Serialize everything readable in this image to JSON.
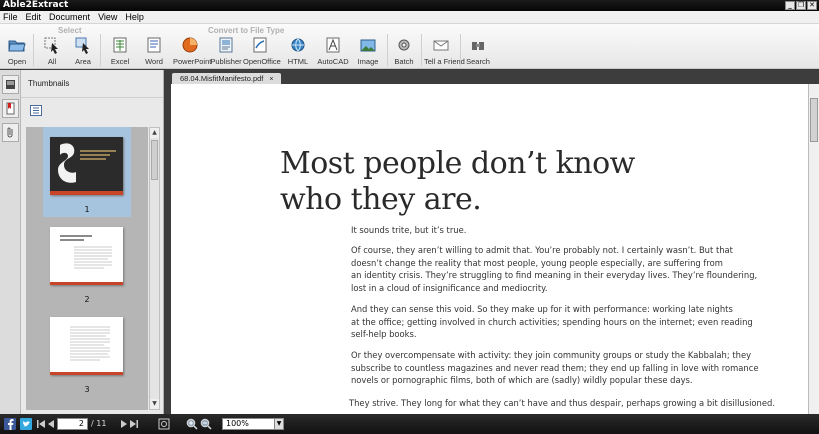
{
  "window": {
    "title": "Able2Extract",
    "controls": [
      "_",
      "❐",
      "✕"
    ]
  },
  "menu": [
    "File",
    "Edit",
    "Document",
    "View",
    "Help"
  ],
  "toolbar": {
    "select_label": "Select",
    "convert_label": "Convert to File Type",
    "buttons": {
      "open": "Open",
      "all": "All",
      "area": "Area",
      "excel": "Excel",
      "word": "Word",
      "powerpoint": "PowerPoint",
      "publisher": "Publisher",
      "openoffice": "OpenOffice",
      "html": "HTML",
      "autocad": "AutoCAD",
      "image": "Image",
      "batch": "Batch",
      "tell_friend": "Tell a Friend",
      "search": "Search"
    }
  },
  "thumbnails": {
    "title": "Thumbnails",
    "pages": [
      {
        "number": "1"
      },
      {
        "number": "2"
      },
      {
        "number": "3"
      }
    ]
  },
  "document": {
    "tab_name": "68.04.MisfitManifesto.pdf",
    "heading_line1": "Most people don’t know",
    "heading_line2": "who they are.",
    "paragraphs": [
      [
        "It sounds trite, but it’s true."
      ],
      [
        "Of course, they aren’t willing to admit that. You’re probably not. I certainly wasn’t. But that",
        "doesn’t change the reality that most people, young people especially, are suffering from",
        "an identity crisis. They’re struggling to find meaning in their everyday lives. They’re floundering,",
        "lost in a cloud of insignificance and mediocrity."
      ],
      [
        "And they can sense this void. So they make up for it with performance: working late nights",
        "at the office; getting involved in church activities; spending hours on the internet; even reading",
        "self-help books."
      ],
      [
        "Or they overcompensate with activity: they join community groups or study the Kabbalah; they",
        "subscribe to countless magazines and never read them; they end up falling in love with romance",
        "novels or pornographic films, both of which are (sadly) wildly popular these days."
      ],
      [
        "They strive. They long for what they can’t have and thus despair, perhaps growing a bit disillusioned."
      ]
    ]
  },
  "statusbar": {
    "current_page": "2",
    "page_count": "/ 11",
    "zoom": "100%"
  },
  "colors": {
    "cover_dark": "#2b2b2b",
    "cover_accent": "#c8452a",
    "thumb_selected": "#a7c4de",
    "facebook": "#3b5998",
    "twitter": "#33a8df"
  }
}
